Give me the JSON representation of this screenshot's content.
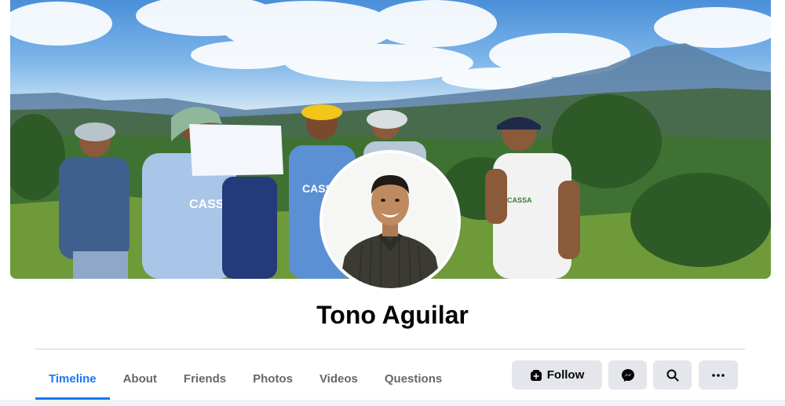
{
  "profile": {
    "name": "Tono Aguilar"
  },
  "tabs": [
    {
      "label": "Timeline",
      "active": true
    },
    {
      "label": "About",
      "active": false
    },
    {
      "label": "Friends",
      "active": false
    },
    {
      "label": "Photos",
      "active": false
    },
    {
      "label": "Videos",
      "active": false
    },
    {
      "label": "Questions",
      "active": false
    }
  ],
  "actions": {
    "follow_label": "Follow",
    "follow_icon": "follow-icon",
    "messenger_icon": "messenger-icon",
    "search_icon": "search-icon",
    "more_icon": "more-icon"
  },
  "cover": {
    "shirt_text": "CASSA"
  },
  "colors": {
    "accent": "#1877f2",
    "button_bg": "#e4e6eb",
    "text_primary": "#050505",
    "text_secondary": "#65676b"
  }
}
